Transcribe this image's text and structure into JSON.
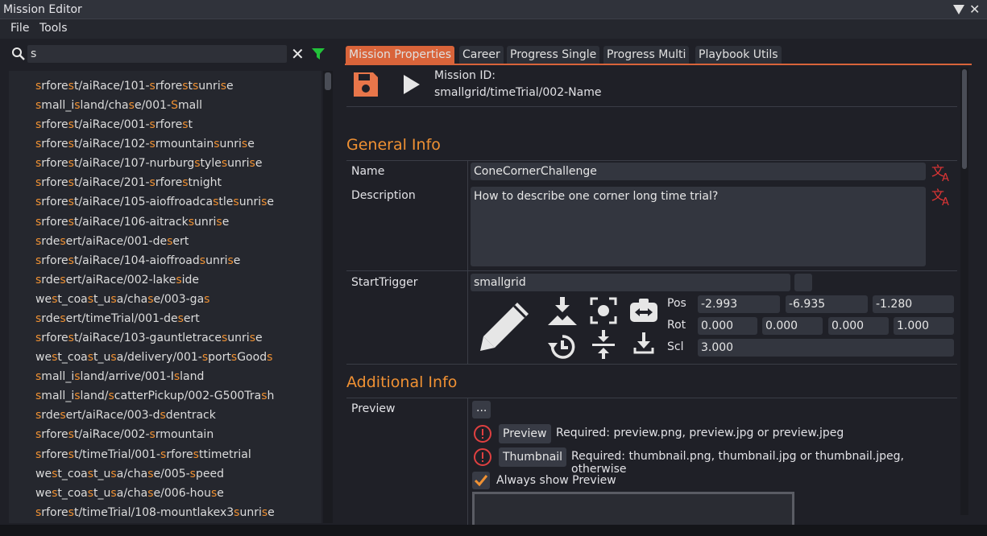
{
  "window": {
    "title": "Mission Editor"
  },
  "menu": {
    "file": "File",
    "tools": "Tools"
  },
  "search": {
    "value": "s",
    "placeholder": ""
  },
  "missions": [
    "srforest/aiRace/101-srforestsunrise",
    "small_island/chase/001-Small",
    "srforest/aiRace/001-srforest",
    "srforest/aiRace/102-srmountainsunrise",
    "srforest/aiRace/107-nurburgstylesunrise",
    "srforest/aiRace/201-srforestnight",
    "srforest/aiRace/105-aioffroadcastlesunrise",
    "srforest/aiRace/106-aitracksunrise",
    "srdesert/aiRace/001-desert",
    "srforest/aiRace/104-aioffroadsunrise",
    "srdesert/aiRace/002-lakeside",
    "west_coast_usa/chase/003-gas",
    "srdesert/timeTrial/001-desert",
    "srforest/aiRace/103-gauntletracesunrise",
    "west_coast_usa/delivery/001-sportsGoods",
    "small_island/arrive/001-Island",
    "small_island/scatterPickup/002-G500Trash",
    "srdesert/aiRace/003-dsdentrack",
    "srforest/aiRace/002-srmountain",
    "srforest/timeTrial/001-srforesttimetrial",
    "west_coast_usa/chase/005-speed",
    "west_coast_usa/chase/006-house",
    "srforest/timeTrial/108-mountlakex3sunrise"
  ],
  "tabs": [
    "Mission Properties",
    "Career",
    "Progress Single",
    "Progress Multi",
    "Playbook Utils"
  ],
  "mission": {
    "id_label": "Mission ID:",
    "id": "smallgrid/timeTrial/002-Name"
  },
  "general": {
    "title": "General Info",
    "name_label": "Name",
    "name": "ConeCornerChallenge",
    "desc_label": "Description",
    "description": "How to describe one corner long time trial?"
  },
  "trigger": {
    "label": "StartTrigger",
    "level": "smallgrid",
    "pos_label": "Pos",
    "pos": [
      "-2.993",
      "-6.935",
      "-1.280"
    ],
    "rot_label": "Rot",
    "rot": [
      "0.000",
      "0.000",
      "0.000",
      "1.000"
    ],
    "scl_label": "Scl",
    "scl": "3.000"
  },
  "additional": {
    "title": "Additional Info",
    "preview_label": "Preview",
    "browse": "...",
    "preview_btn": "Preview",
    "preview_req": "Required: preview.png, preview.jpg or preview.jpeg",
    "thumb_btn": "Thumbnail",
    "thumb_req": "Required: thumbnail.png, thumbnail.jpg or thumbnail.jpeg, otherwise",
    "always_show": "Always show Preview"
  },
  "colors": {
    "accent": "#f09133",
    "active_tab": "#d9643a",
    "warning": "#e04040",
    "save": "#e8764a"
  }
}
